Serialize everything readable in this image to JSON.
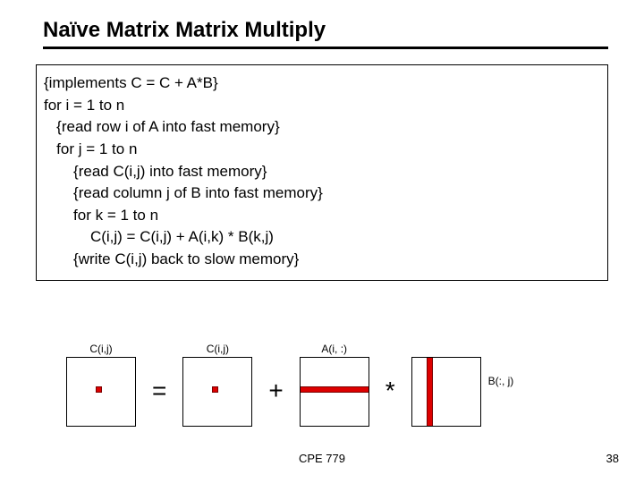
{
  "title": "Naïve Matrix Matrix Multiply",
  "code": {
    "l1": "{implements C = C + A*B}",
    "l2": "for i = 1 to n",
    "l3": "   {read row i of A into fast memory}",
    "l4": "   for j = 1 to n",
    "l5": "       {read C(i,j) into fast memory}",
    "l6": "       {read column j of B into fast memory}",
    "l7": "       for k = 1 to n",
    "l8": "           C(i,j) = C(i,j) + A(i,k) * B(k,j)",
    "l9": "       {write C(i,j) back to slow memory}"
  },
  "diagram": {
    "c1_label": "C(i,j)",
    "eq": "=",
    "c2_label": "C(i,j)",
    "plus": "+",
    "a_label": "A(i, :)",
    "star": "*",
    "b_label": "B(:, j)"
  },
  "footer": {
    "center": "CPE 779",
    "page": "38"
  }
}
